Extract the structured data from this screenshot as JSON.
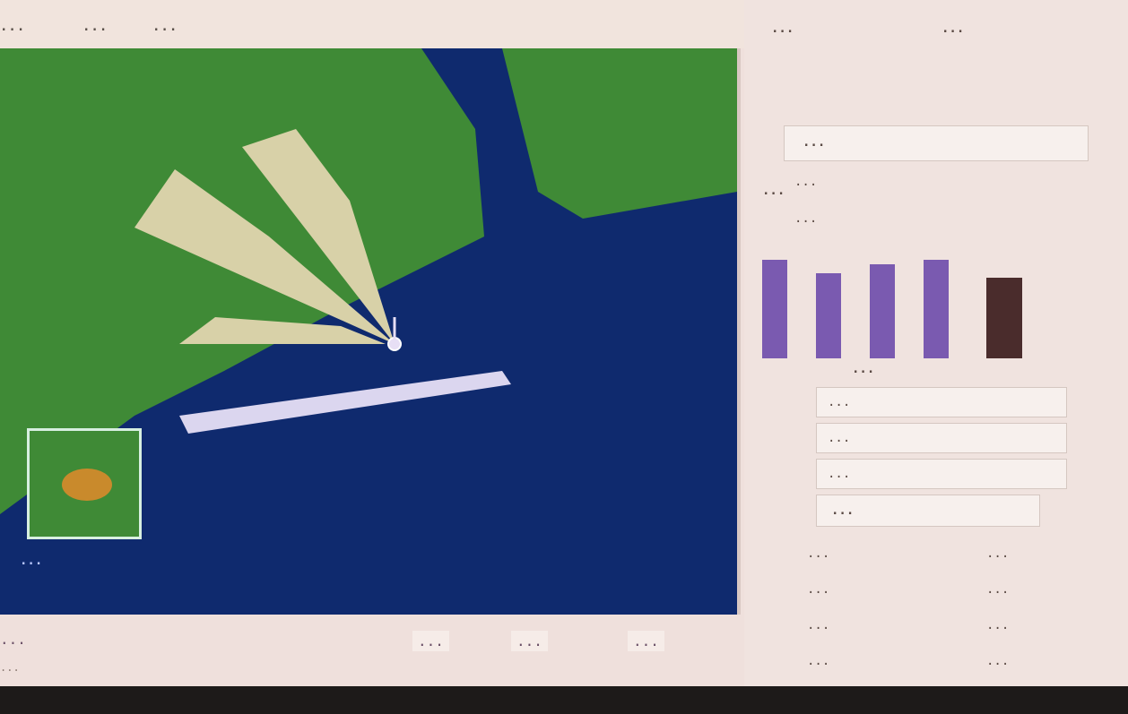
{
  "menu": {
    "items": [
      "...",
      "...",
      "..."
    ]
  },
  "map": {
    "unit_label": "...",
    "colors": {
      "ocean": "#0f2a6e",
      "land": "#3f8a36",
      "arc": "#d8d1a8",
      "selection": "#e7dff5"
    }
  },
  "status": {
    "left_text": "...",
    "fields": [
      "...",
      "...",
      "..."
    ],
    "bottom_text": "..."
  },
  "sidebar": {
    "header_left": "...",
    "header_right": "...",
    "section_title": "...",
    "mode_label": "...",
    "lines": [
      "...",
      "..."
    ],
    "bars_title": "...",
    "buttons": [
      "...",
      "...",
      "..."
    ],
    "fire_label": "...",
    "table": {
      "left": [
        "...",
        "...",
        "...",
        "..."
      ],
      "right": [
        "...",
        "...",
        "...",
        "..."
      ]
    }
  }
}
